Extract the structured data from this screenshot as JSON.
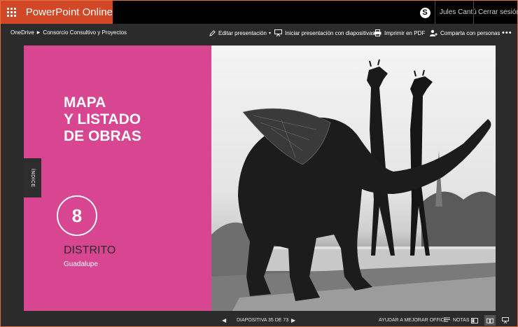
{
  "app": {
    "title": "PowerPoint Online",
    "accent_color": "#d24726",
    "user_name": "Jules Cantú",
    "sign_out": "Cerrar sesión"
  },
  "breadcrumb": {
    "root": "OneDrive",
    "folder": "Consorcio Consultivo y Proyectos"
  },
  "commands": {
    "edit": "Editar presentación",
    "present": "Iniciar presentación con diapositivas",
    "print": "Imprimir en PDF",
    "share": "Comparta con personas",
    "more": "•••"
  },
  "slide": {
    "title_lines": [
      "MAPA",
      "Y LISTADO",
      "DE OBRAS"
    ],
    "tab_label": "ÍNDICE",
    "number": "8",
    "district": "DISTRITO",
    "district_name": "Guadalupe",
    "pink_color": "#d84691"
  },
  "status": {
    "counter": "DIAPOSITIVA 35 DE 73",
    "help": "AYUDAR A MEJORAR OFFICE",
    "notes": "NOTAS"
  }
}
